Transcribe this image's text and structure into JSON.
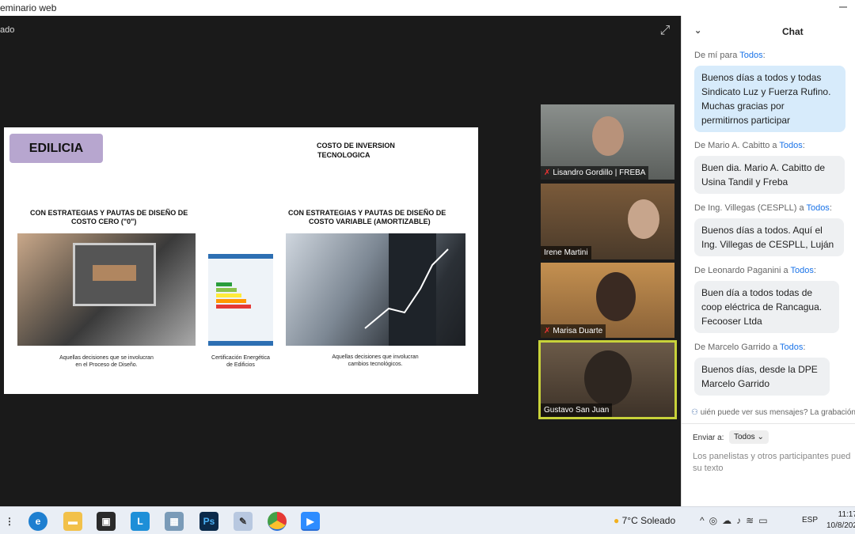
{
  "window": {
    "title": "eminario web"
  },
  "video": {
    "label": "ado"
  },
  "slide": {
    "tag": "EDILICIA",
    "title_line1": "COSTO  DE  INVERSION",
    "title_line2": "TECNOLOGICA",
    "left_heading_1": "CON ESTRATEGIAS Y PAUTAS DE DISEÑO DE",
    "left_heading_2": "COSTO CERO (\"0\")",
    "right_heading_1": "CON ESTRATEGIAS Y PAUTAS DE DISEÑO  DE",
    "right_heading_2": "COSTO VARIABLE (AMORTIZABLE)",
    "caption_left_1": "Aquellas decisiones que se involucran",
    "caption_left_2": "en el Proceso de Diseño.",
    "caption_mid_1": "Certificación Energética",
    "caption_mid_2": "de Edificios",
    "caption_right_1": "Aquellas decisiones que involucran",
    "caption_right_2": "cambios tecnológicos."
  },
  "participants": [
    {
      "name": "Lisandro Gordillo | FREBA",
      "muted": true
    },
    {
      "name": "Irene Martini",
      "muted": false
    },
    {
      "name": "Marisa Duarte",
      "muted": true
    },
    {
      "name": "Gustavo San Juan",
      "muted": false
    }
  ],
  "chat": {
    "title": "Chat",
    "messages": [
      {
        "from": "De mí para",
        "to": "Todos",
        "text_lines": [
          "Buenos días a todos y todas",
          "Sindicato Luz y Fuerza Rufino.",
          "Muchas gracias por",
          "permitirnos participar"
        ]
      },
      {
        "from": "De Mario A. Cabitto a",
        "to": "Todos",
        "text_lines": [
          "Buen dia. Mario A. Cabitto de",
          "Usina Tandil y Freba"
        ]
      },
      {
        "from": "De Ing. Villegas (CESPLL) a",
        "to": "Todos",
        "text_lines": [
          "Buenos días a todos. Aquí el",
          "Ing. Villegas de CESPLL, Luján"
        ]
      },
      {
        "from": "De Leonardo Paganini a",
        "to": "Todos",
        "text_lines": [
          "Buen día a todos todas de",
          "coop eléctrica de Rancagua.",
          "Fecooser Ltda"
        ]
      },
      {
        "from": "De Marcelo Garrido a",
        "to": "Todos",
        "text_lines": [
          "Buenos días, desde la DPE",
          "Marcelo Garrido"
        ]
      }
    ],
    "notice": "uién puede ver sus mensajes? La grabación",
    "send_to_label": "Enviar a:",
    "send_to_value": "Todos",
    "placeholder_1": "Los panelistas y otros participantes pued",
    "placeholder_2": "su texto"
  },
  "taskbar": {
    "weather_temp": "7°C",
    "weather_desc": "Soleado",
    "lang": "ESP",
    "time": "11:17",
    "date": "10/8/202"
  },
  "colors": {
    "accent": "#1a73e8",
    "tag": "#b7a6cf",
    "active_border": "#c8d23a"
  }
}
